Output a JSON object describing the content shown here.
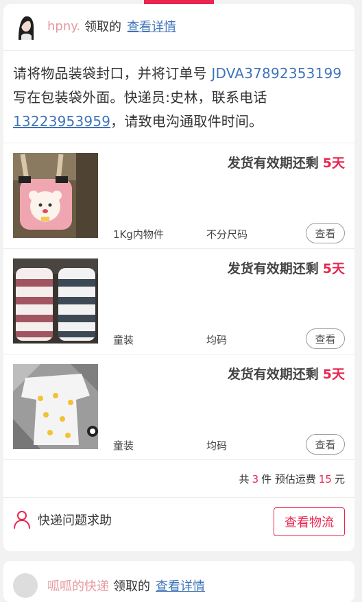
{
  "post": {
    "username": "hpny.",
    "claimed_text": "领取的",
    "detail_link": "查看详情",
    "notice": {
      "part1": "请将物品装袋封口，并将订单号 ",
      "order_no": "JDVA37892353199",
      "part2": " 写在包装袋外面。快递员:史林，联系电话",
      "phone": "13223953959",
      "part3": "，请致电沟通取件时间。"
    },
    "items": [
      {
        "validity_label": "发货有效期还剩",
        "validity_days": "5天",
        "attr1": "1Kg内物件",
        "attr2": "不分尺码",
        "view_label": "查看"
      },
      {
        "validity_label": "发货有效期还剩",
        "validity_days": "5天",
        "attr1": "童装",
        "attr2": "均码",
        "view_label": "查看"
      },
      {
        "validity_label": "发货有效期还剩",
        "validity_days": "5天",
        "attr1": "童装",
        "attr2": "均码",
        "view_label": "查看"
      }
    ],
    "summary": {
      "prefix": "共",
      "count": "3",
      "mid": "件 预估运费",
      "fee": "15",
      "suffix": "元"
    },
    "help_label": "快递问题求助",
    "logistics_button": "查看物流"
  },
  "next_post": {
    "username": "呱呱的快递",
    "claimed_text": "领取的",
    "detail_link": "查看详情"
  },
  "colors": {
    "accent": "#e8264f",
    "link": "#3e74b8",
    "username": "#e59aa1"
  },
  "icons": [
    "user-avatar",
    "person-outline-icon"
  ]
}
